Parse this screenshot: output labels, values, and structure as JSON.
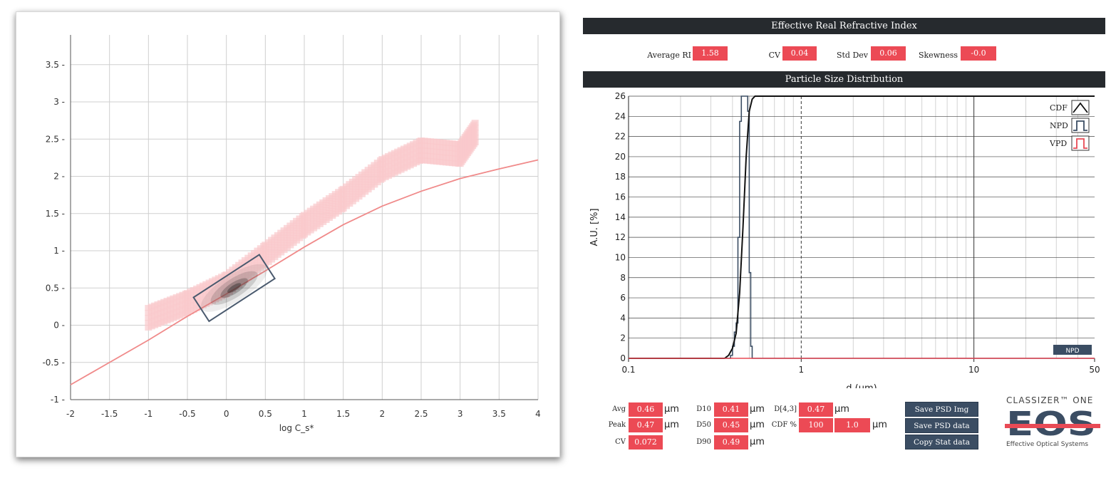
{
  "left_plot": {
    "x_ticks": [
      "-2",
      "-1.5",
      "-1",
      "-0.5",
      "0",
      "0.5",
      "1",
      "1.5",
      "2",
      "2.5",
      "3",
      "3.5",
      "4"
    ],
    "y_ticks": [
      "-1",
      "-0.5",
      "0",
      "0.5",
      "1",
      "1.5",
      "2",
      "2.5",
      "3",
      "3.5"
    ],
    "xlabel_partial": "log C_s*",
    "curve_color": "#f08a8a",
    "density_color": "#f9c9cc"
  },
  "ri": {
    "title": "Effective Real Refractive Index",
    "avg_label": "Average RI",
    "avg_value": "1.58",
    "cv_label": "CV",
    "cv_value": "0.04",
    "std_label": "Std Dev",
    "std_value": "0.06",
    "skew_label": "Skewness",
    "skew_value": "-0.0"
  },
  "psd": {
    "title": "Particle Size Distribution",
    "ylabel": "A.U. [%]",
    "xlabel": "d (µm)",
    "x_ticks": [
      "0.1",
      "1",
      "10",
      "50"
    ],
    "y_ticks": [
      "0",
      "2",
      "4",
      "6",
      "8",
      "10",
      "12",
      "14",
      "16",
      "18",
      "20",
      "22",
      "24",
      "26"
    ],
    "legend": [
      "CDF",
      "NPD",
      "VPD"
    ],
    "mode_badge": "NPD"
  },
  "stats": {
    "avg_label": "Avg",
    "avg_value": "0.46",
    "peak_label": "Peak",
    "peak_value": "0.47",
    "cv_label": "CV",
    "cv_value": "0.072",
    "d10_label": "D10",
    "d10_value": "0.41",
    "d50_label": "D50",
    "d50_value": "0.45",
    "d90_label": "D90",
    "d90_value": "0.49",
    "d43_label": "D[4,3]",
    "d43_value": "0.47",
    "cdf_label": "CDF %",
    "cdf_value": "100",
    "cdf_d_value": "1.0",
    "unit": "µm"
  },
  "buttons": {
    "save_img": "Save PSD Img",
    "save_data": "Save PSD data",
    "copy_stat": "Copy Stat data"
  },
  "logo": {
    "top": "CLASSIZER™ ONE",
    "mark": "EOS",
    "sub": "Effective Optical Systems"
  },
  "chart_data": [
    {
      "type": "scatter",
      "title": "",
      "xlabel": "log C_s*",
      "ylabel": "",
      "xlim": [
        -2,
        4
      ],
      "ylim": [
        -1,
        3.9
      ],
      "curve": {
        "x": [
          -2,
          -1.5,
          -1,
          -0.5,
          0,
          0.5,
          1,
          1.5,
          2,
          2.5,
          3,
          3.5,
          4
        ],
        "y": [
          -0.8,
          -0.5,
          -0.2,
          0.12,
          0.42,
          0.73,
          1.05,
          1.35,
          1.6,
          1.8,
          1.97,
          2.1,
          2.22
        ]
      },
      "density_band": {
        "x": [
          -1.0,
          -0.5,
          0.0,
          0.5,
          1.0,
          1.5,
          2.0,
          2.5,
          3.0,
          3.2
        ],
        "y": [
          0.1,
          0.3,
          0.55,
          0.95,
          1.35,
          1.7,
          2.1,
          2.35,
          2.3,
          2.6
        ]
      },
      "gate": {
        "x_center": 0.1,
        "y_center": 0.5
      }
    },
    {
      "type": "line",
      "title": "Particle Size Distribution",
      "xlabel": "d (µm)",
      "ylabel": "A.U. [%]",
      "xscale": "log",
      "xlim": [
        0.1,
        50
      ],
      "ylim": [
        0,
        26
      ],
      "series": [
        {
          "name": "NPD",
          "x": [
            0.1,
            0.38,
            0.39,
            0.4,
            0.41,
            0.42,
            0.43,
            0.44,
            0.45,
            0.46,
            0.47,
            0.48,
            0.49,
            0.5,
            0.51,
            0.52,
            0.55,
            50
          ],
          "y": [
            0,
            0,
            0.3,
            1.2,
            2.6,
            3.5,
            12.0,
            23.5,
            26,
            26,
            26,
            26,
            24.5,
            8.5,
            1.2,
            0,
            0,
            0
          ]
        },
        {
          "name": "CDF",
          "x": [
            0.1,
            0.36,
            0.38,
            0.4,
            0.42,
            0.44,
            0.46,
            0.48,
            0.5,
            0.52,
            0.54,
            0.56,
            0.6,
            50
          ],
          "y": [
            0,
            0,
            0.3,
            1.0,
            2.5,
            6.5,
            13.0,
            20.0,
            24.5,
            25.7,
            26,
            26,
            26,
            26
          ]
        },
        {
          "name": "VPD",
          "x": [
            0.1,
            50
          ],
          "y": [
            0,
            0
          ]
        }
      ]
    }
  ]
}
